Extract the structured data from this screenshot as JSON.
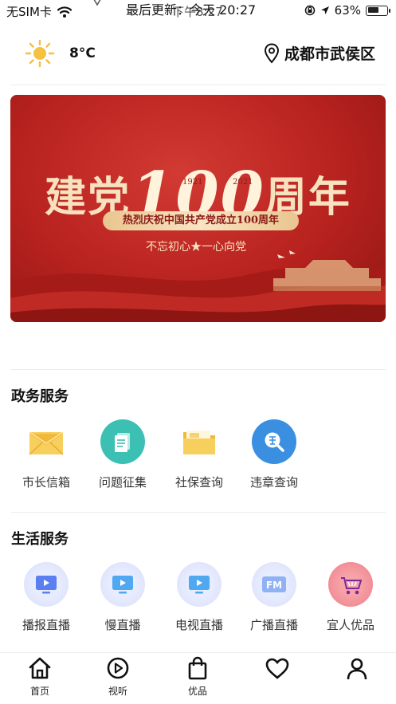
{
  "status_bar": {
    "carrier": "无SIM卡",
    "update_text": "最后更新：今天 20:27",
    "time": "下午8:27",
    "battery_percent": "63%",
    "battery_level": 0.63
  },
  "header": {
    "weather_icon": "sun-icon",
    "temperature": "8°C",
    "location_icon": "location-pin-icon",
    "location": "成都市武侯区"
  },
  "banner": {
    "title_left": "建党",
    "title_number": "100",
    "title_right": "周年",
    "year_start": "1921",
    "year_end": "2021",
    "subtitle": "热烈庆祝中国共产党成立100周年",
    "slogan": "不忘初心★一心向党"
  },
  "government_services": {
    "title": "政务服务",
    "items": [
      {
        "label": "市长信箱",
        "icon": "envelope-icon"
      },
      {
        "label": "问题征集",
        "icon": "document-icon"
      },
      {
        "label": "社保查询",
        "icon": "folder-icon"
      },
      {
        "label": "违章查询",
        "icon": "violation-search-icon"
      }
    ]
  },
  "life_services": {
    "title": "生活服务",
    "items": [
      {
        "label": "播报直播",
        "icon": "tv-play-icon"
      },
      {
        "label": "慢直播",
        "icon": "tv-play-icon"
      },
      {
        "label": "电视直播",
        "icon": "tv-play-icon"
      },
      {
        "label": "广播直播",
        "icon": "fm-icon"
      },
      {
        "label": "宜人优品",
        "icon": "shopping-cart-icon"
      }
    ]
  },
  "tabbar": {
    "items": [
      {
        "label": "首页",
        "icon": "home-icon"
      },
      {
        "label": "视听",
        "icon": "play-icon"
      },
      {
        "label": "优品",
        "icon": "shopping-bag-icon"
      },
      {
        "label": "",
        "icon": "heart-icon"
      },
      {
        "label": "",
        "icon": "user-icon"
      }
    ]
  },
  "colors": {
    "banner_red": "#b8221f",
    "gold": "#f7e2bf",
    "teal": "#3cc0b3",
    "blue": "#3a8fe0",
    "yellow": "#f5c141"
  }
}
